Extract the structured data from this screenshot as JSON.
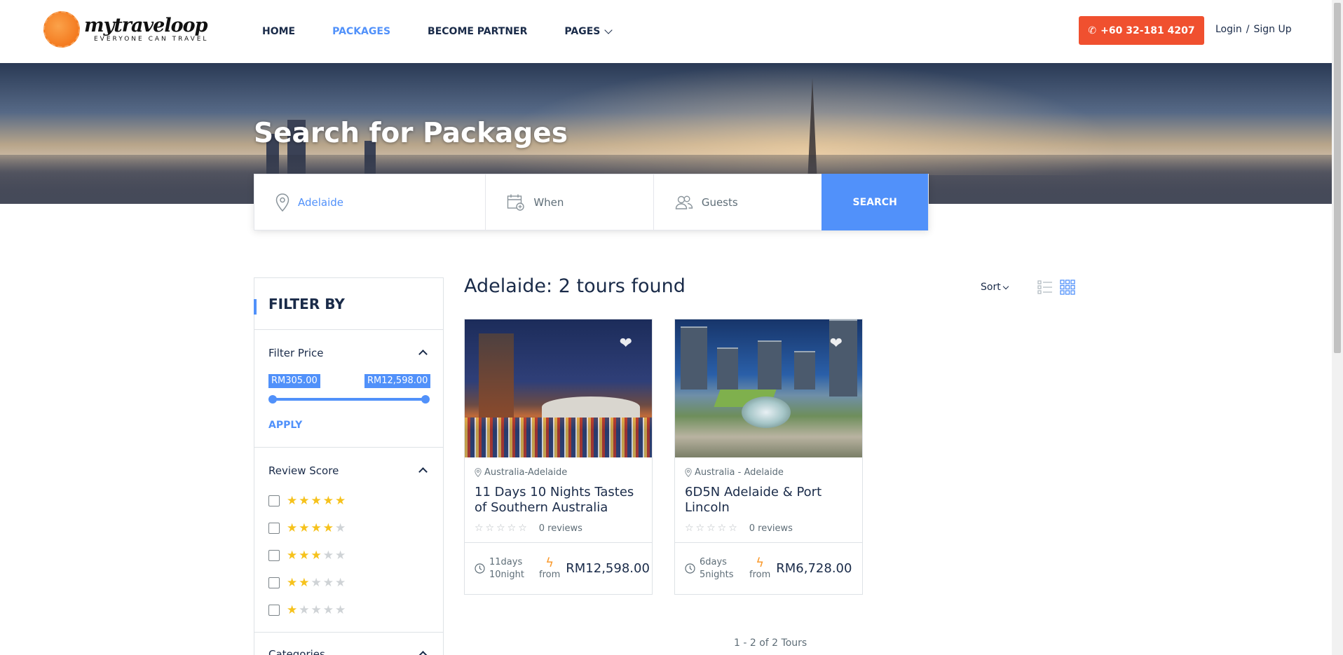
{
  "brand": {
    "name": "mytraveloop",
    "tagline": "EVERYONE CAN TRAVEL"
  },
  "nav": {
    "items": [
      {
        "label": "HOME"
      },
      {
        "label": "PACKAGES"
      },
      {
        "label": "BECOME PARTNER"
      },
      {
        "label": "PAGES"
      }
    ],
    "phone": "+60 32-181 4207",
    "login": "Login",
    "separator": "/",
    "signup": "Sign Up"
  },
  "hero": {
    "title": "Search for Packages"
  },
  "search": {
    "location_value": "Adelaide",
    "when_placeholder": "When",
    "guests_placeholder": "Guests",
    "button": "SEARCH"
  },
  "filters": {
    "heading": "FILTER BY",
    "price": {
      "title": "Filter Price",
      "min": "RM305.00",
      "max": "RM12,598.00",
      "apply": "APPLY"
    },
    "review": {
      "title": "Review Score",
      "levels": [
        5,
        4,
        3,
        2,
        1
      ]
    },
    "categories": {
      "title": "Categories"
    }
  },
  "results": {
    "title": "Adelaide: 2 tours found",
    "sort_label": "Sort",
    "paging": "1 - 2 of 2 Tours",
    "tours": [
      {
        "location": "Australia-Adelaide",
        "title": "11 Days 10 Nights Tastes of Southern Australia",
        "reviews": "0 reviews",
        "days": "11days",
        "nights": "10night",
        "from": "from",
        "price": "RM12,598.00"
      },
      {
        "location": "Australia - Adelaide",
        "title": "6D5N Adelaide & Port Lincoln",
        "reviews": "0 reviews",
        "days": "6days",
        "nights": "5nights",
        "from": "from",
        "price": "RM6,728.00"
      }
    ]
  },
  "colors": {
    "accent": "#5191fa",
    "phone_button": "#f0502f",
    "star": "#f6c21c",
    "text": "#1a2b49"
  },
  "icons": [
    "phone-icon",
    "map-pin-icon",
    "calendar-icon",
    "guests-icon",
    "heart-icon",
    "clock-icon",
    "bolt-icon",
    "list-view-icon",
    "grid-view-icon",
    "star-icon"
  ]
}
